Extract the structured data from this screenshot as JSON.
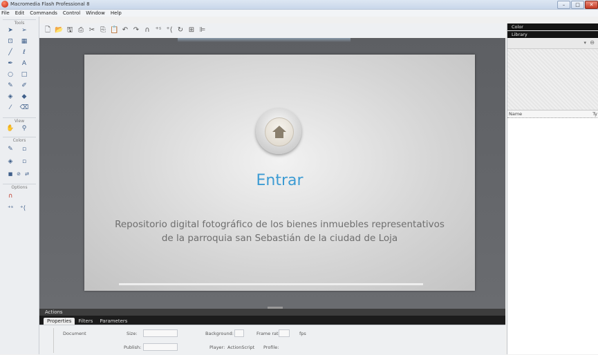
{
  "window": {
    "title": "Macromedia Flash Professional 8",
    "buttons": {
      "minimize": "–",
      "maximize": "□",
      "close": "✕"
    }
  },
  "menu": [
    "File",
    "Edit",
    "Commands",
    "Control",
    "Window",
    "Help"
  ],
  "tools": {
    "title": "Tools",
    "view_label": "View",
    "colors_label": "Colors",
    "options_label": "Options"
  },
  "stage": {
    "button_label": "Entrar",
    "description_line1": "Repositorio digital fotográfico de los bienes inmuebles representativos",
    "description_line2": "de la parroquia san Sebastián de la ciudad de Loja"
  },
  "panels": {
    "actions": "Actions",
    "tabs": [
      "Properties",
      "Filters",
      "Parameters"
    ],
    "document_label": "Document",
    "size_label": "Size:",
    "background_label": "Background:",
    "frame_rate_label": "Frame rate:",
    "fps_label": "fps",
    "publish_label": "Publish:",
    "player_label": "Player:",
    "actionscript_label": "ActionScript",
    "profile_label": "Profile:"
  },
  "right_panels": {
    "color_title": "Color",
    "library_title": "Library",
    "name_header": "Name",
    "type_header": "Ty"
  },
  "colors": {
    "accent": "#3c9bd3",
    "stage_bg": "#d4d4d4",
    "work_area": "#5d5f63"
  }
}
